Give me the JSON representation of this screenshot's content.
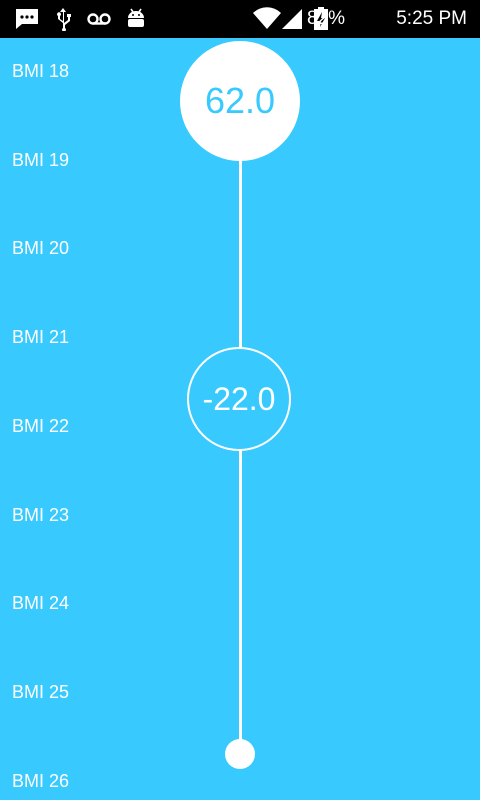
{
  "status_bar": {
    "battery_percent": "82%",
    "time": "5:25 PM",
    "icons": [
      "message-icon",
      "usb-icon",
      "voicemail-icon",
      "android-icon",
      "wifi-icon",
      "signal-icon",
      "battery-charging-icon"
    ]
  },
  "bmi_scale": {
    "labels": [
      "BMI 18",
      "BMI 19",
      "BMI 20",
      "BMI 21",
      "BMI 22",
      "BMI 23",
      "BMI 24",
      "BMI 25",
      "BMI 26"
    ]
  },
  "slider": {
    "top_value": "62.0",
    "middle_value": "-22.0"
  },
  "colors": {
    "background": "#38cafe",
    "foreground": "#ffffff"
  }
}
